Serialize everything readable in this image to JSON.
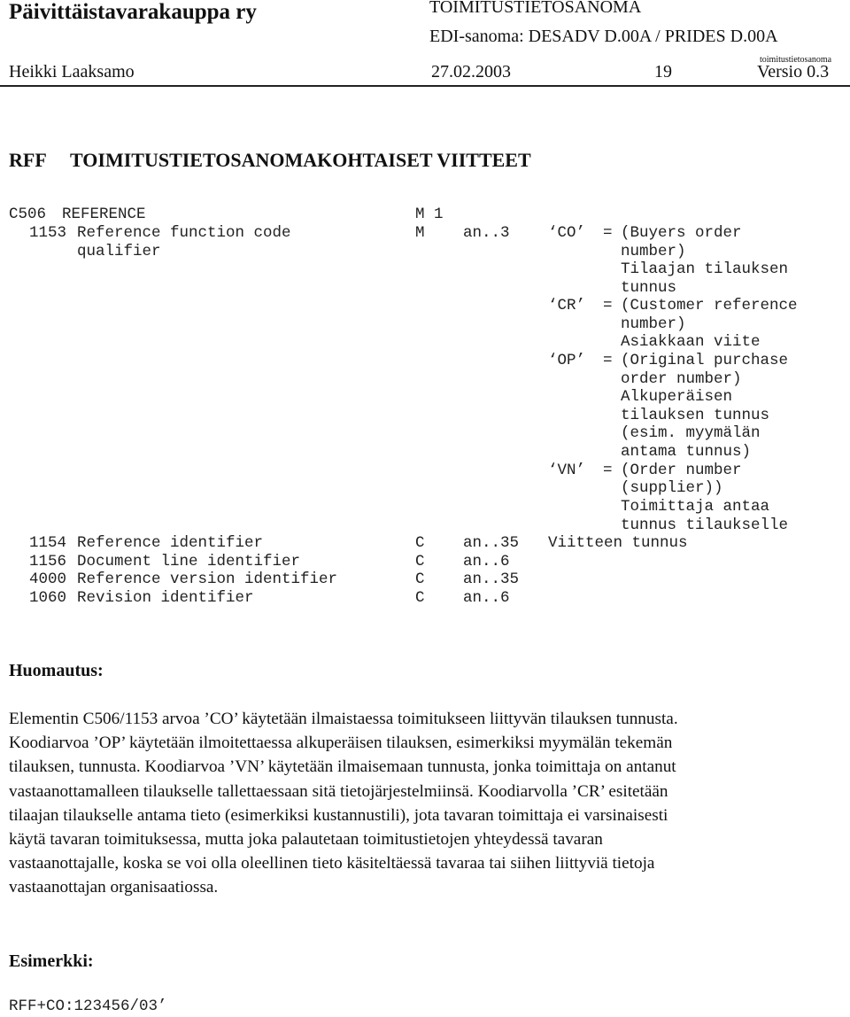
{
  "header": {
    "organization": "Päivittäistavarakauppa ry",
    "message_title": "TOIMITUSTIETOSANOMA",
    "edi_message": "EDI-sanoma: DESADV D.00A / PRIDES D.00A",
    "author": "Heikki Laaksamo",
    "date": "27.02.2003",
    "page": "19",
    "doc_tag": "toimitustietosanoma",
    "version": "Versio 0.3"
  },
  "section": {
    "code": "RFF",
    "title": "TOIMITUSTIETOSANOMAKOHTAISET VIITTEET"
  },
  "segment_table": {
    "composite": {
      "code": "C506",
      "name": "REFERENCE",
      "status": "M",
      "repeat": "1"
    },
    "elements": [
      {
        "code": "1153",
        "name": "Reference function code",
        "name_cont": "qualifier",
        "status": "M",
        "format": "an..3"
      },
      {
        "code": "1154",
        "name": "Reference identifier",
        "status": "C",
        "format": "an..35",
        "note": "Viitteen tunnus"
      },
      {
        "code": "1156",
        "name": "Document line identifier",
        "status": "C",
        "format": "an..6"
      },
      {
        "code": "4000",
        "name": "Reference version identifier",
        "status": "C",
        "format": "an..35"
      },
      {
        "code": "1060",
        "name": "Revision identifier",
        "status": "C",
        "format": "an..6"
      }
    ],
    "code_values": [
      {
        "code": "‘CO’",
        "eq": "=",
        "lines": [
          "(Buyers order",
          " number)",
          "Tilaajan tilauksen",
          "tunnus"
        ]
      },
      {
        "code": "‘CR’",
        "eq": "=",
        "lines": [
          "(Customer reference",
          " number)",
          "Asiakkaan viite"
        ]
      },
      {
        "code": "‘OP’",
        "eq": "=",
        "lines": [
          "(Original purchase",
          " order number)",
          "Alkuperäisen",
          "tilauksen tunnus",
          "(esim. myymälän",
          " antama tunnus)"
        ]
      },
      {
        "code": "‘VN’",
        "eq": "=",
        "lines": [
          "(Order number",
          "  (supplier))",
          "Toimittaja antaa",
          "tunnus tilaukselle"
        ]
      }
    ]
  },
  "remark": {
    "heading": "Huomautus:",
    "lines": [
      "Elementin C506/1153 arvoa ’CO’ käytetään ilmaistaessa toimitukseen liittyvän tilauksen tunnusta.",
      "Koodiarvoa ’OP’ käytetään ilmoitettaessa alkuperäisen tilauksen, esimerkiksi myymälän tekemän",
      "tilauksen, tunnusta. Koodiarvoa ’VN’ käytetään ilmaisemaan tunnusta, jonka toimittaja on antanut",
      "vastaanottamalleen tilaukselle tallettaessaan sitä tietojärjestelmiinsä. Koodiarvolla ’CR’ esitetään",
      "tilaajan tilaukselle antama tieto (esimerkiksi kustannustili), jota tavaran toimittaja ei varsinaisesti",
      "käytä tavaran toimituksessa, mutta joka palautetaan toimitustietojen yhteydessä tavaran",
      "vastaanottajalle, koska se voi olla oleellinen tieto käsiteltäessä tavaraa tai siihen liittyviä tietoja",
      "vastaanottajan organisaatiossa."
    ]
  },
  "example": {
    "heading": "Esimerkki:",
    "code": "RFF+CO:123456/03’"
  }
}
